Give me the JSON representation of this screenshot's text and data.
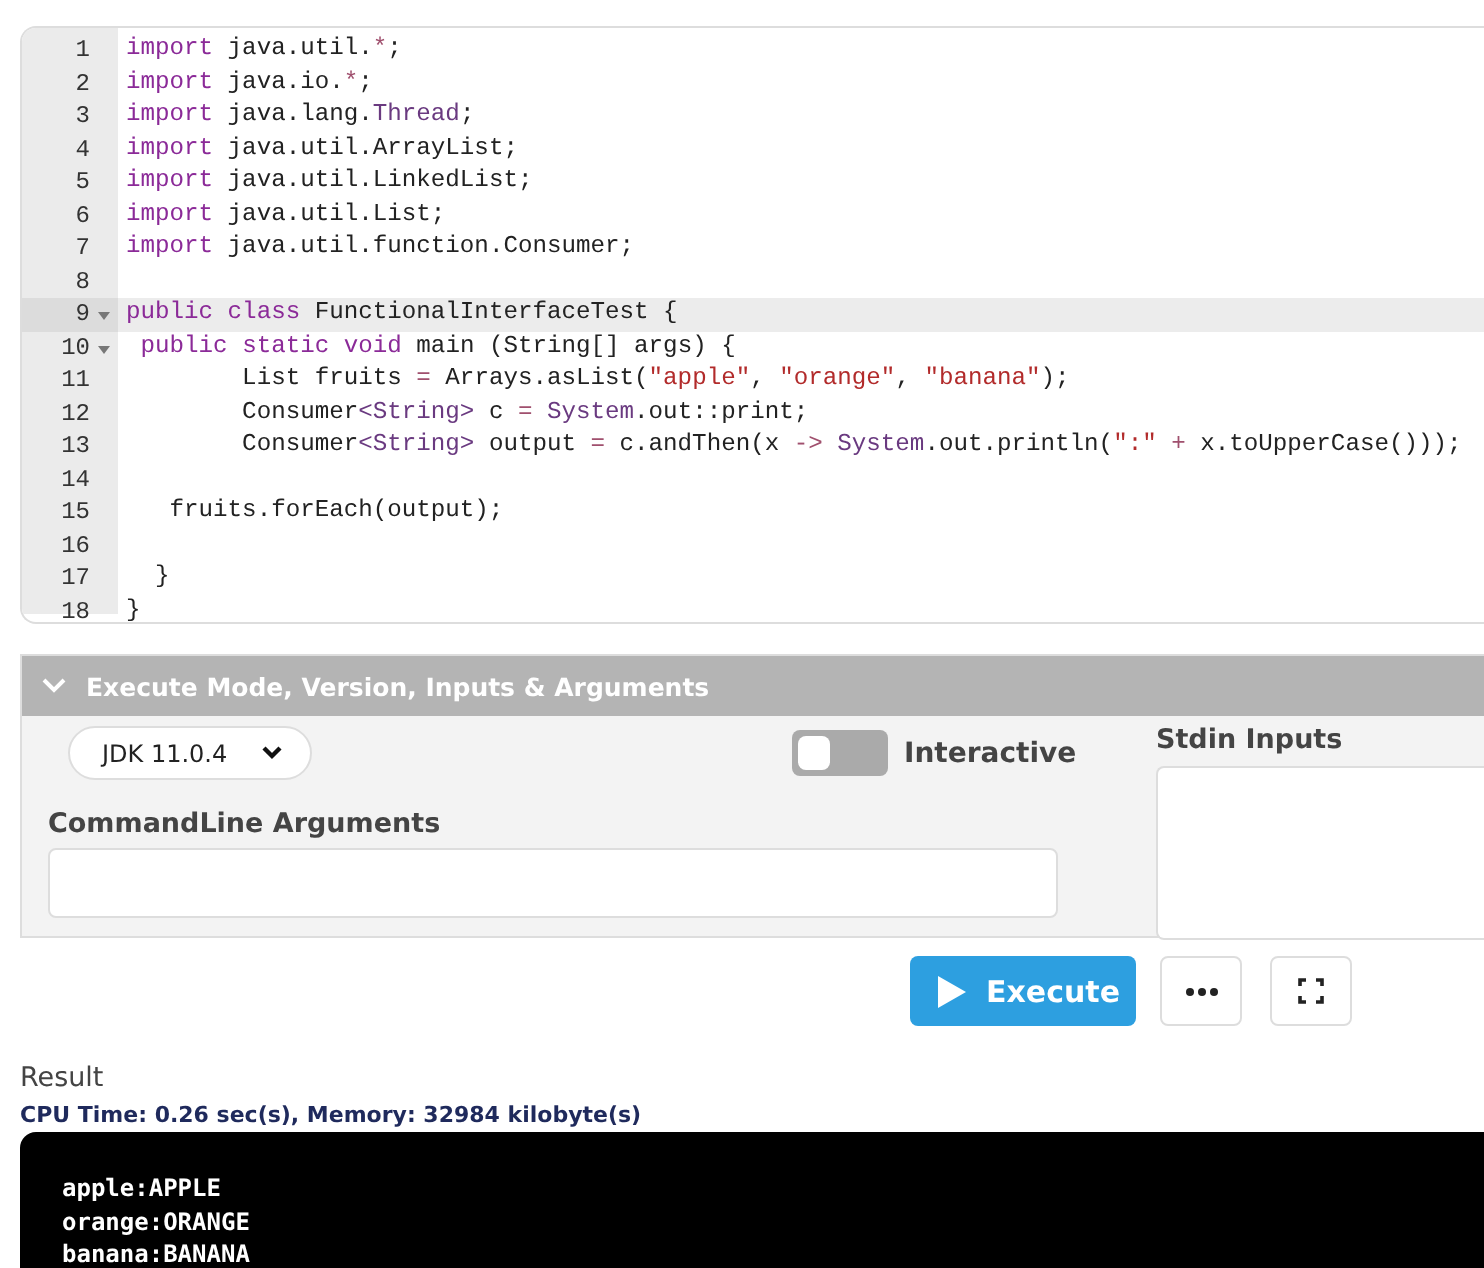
{
  "editor": {
    "lines": [
      {
        "number": "1",
        "foldable": false,
        "current": false,
        "tokens": [
          {
            "kind": "kw",
            "text": "import"
          },
          {
            "kind": "plain",
            "text": " java.util."
          },
          {
            "kind": "op",
            "text": "*"
          },
          {
            "kind": "plain",
            "text": ";"
          }
        ]
      },
      {
        "number": "2",
        "foldable": false,
        "current": false,
        "tokens": [
          {
            "kind": "kw",
            "text": "import"
          },
          {
            "kind": "plain",
            "text": " java.io."
          },
          {
            "kind": "op",
            "text": "*"
          },
          {
            "kind": "plain",
            "text": ";"
          }
        ]
      },
      {
        "number": "3",
        "foldable": false,
        "current": false,
        "tokens": [
          {
            "kind": "kw",
            "text": "import"
          },
          {
            "kind": "plain",
            "text": " java.lang."
          },
          {
            "kind": "type",
            "text": "Thread"
          },
          {
            "kind": "plain",
            "text": ";"
          }
        ]
      },
      {
        "number": "4",
        "foldable": false,
        "current": false,
        "tokens": [
          {
            "kind": "kw",
            "text": "import"
          },
          {
            "kind": "plain",
            "text": " java.util.ArrayList;"
          }
        ]
      },
      {
        "number": "5",
        "foldable": false,
        "current": false,
        "tokens": [
          {
            "kind": "kw",
            "text": "import"
          },
          {
            "kind": "plain",
            "text": " java.util.LinkedList;"
          }
        ]
      },
      {
        "number": "6",
        "foldable": false,
        "current": false,
        "tokens": [
          {
            "kind": "kw",
            "text": "import"
          },
          {
            "kind": "plain",
            "text": " java.util.List;"
          }
        ]
      },
      {
        "number": "7",
        "foldable": false,
        "current": false,
        "tokens": [
          {
            "kind": "kw",
            "text": "import"
          },
          {
            "kind": "plain",
            "text": " java.util.function.Consumer;"
          }
        ]
      },
      {
        "number": "8",
        "foldable": false,
        "current": false
      },
      {
        "number": "9",
        "foldable": true,
        "current": true,
        "tokens": [
          {
            "kind": "kw",
            "text": "public"
          },
          {
            "kind": "kw",
            "text": " class"
          },
          {
            "kind": "plain",
            "text": " FunctionalInterfaceTest {"
          }
        ]
      },
      {
        "number": "10",
        "foldable": true,
        "current": false,
        "tokens": [
          {
            "kind": "kw",
            "text": " public"
          },
          {
            "kind": "kw",
            "text": " static"
          },
          {
            "kind": "kw",
            "text": " void"
          },
          {
            "kind": "plain",
            "text": " main (String[] args) {"
          }
        ]
      },
      {
        "number": "11",
        "foldable": false,
        "current": false,
        "tokens": [
          {
            "kind": "plain",
            "text": "        List fruits "
          },
          {
            "kind": "op",
            "text": "="
          },
          {
            "kind": "plain",
            "text": " Arrays.asList("
          },
          {
            "kind": "str",
            "text": "\"apple\""
          },
          {
            "kind": "plain",
            "text": ", "
          },
          {
            "kind": "str",
            "text": "\"orange\""
          },
          {
            "kind": "plain",
            "text": ", "
          },
          {
            "kind": "str",
            "text": "\"banana\""
          },
          {
            "kind": "plain",
            "text": ");"
          }
        ]
      },
      {
        "number": "12",
        "foldable": false,
        "current": false,
        "tokens": [
          {
            "kind": "plain",
            "text": "        Consumer"
          },
          {
            "kind": "type",
            "text": "<String>"
          },
          {
            "kind": "plain",
            "text": " c "
          },
          {
            "kind": "op",
            "text": "="
          },
          {
            "kind": "type",
            "text": " System"
          },
          {
            "kind": "plain",
            "text": ".out::print;"
          }
        ]
      },
      {
        "number": "13",
        "foldable": false,
        "current": false,
        "tokens": [
          {
            "kind": "plain",
            "text": "        Consumer"
          },
          {
            "kind": "type",
            "text": "<String>"
          },
          {
            "kind": "plain",
            "text": " output "
          },
          {
            "kind": "op",
            "text": "="
          },
          {
            "kind": "plain",
            "text": " c.andThen(x "
          },
          {
            "kind": "op",
            "text": "->"
          },
          {
            "kind": "type",
            "text": " System"
          },
          {
            "kind": "plain",
            "text": ".out.println("
          },
          {
            "kind": "str",
            "text": "\":\""
          },
          {
            "kind": "op",
            "text": " +"
          },
          {
            "kind": "plain",
            "text": " x.toUpperCase()));"
          }
        ]
      },
      {
        "number": "14",
        "foldable": false,
        "current": false
      },
      {
        "number": "15",
        "foldable": false,
        "current": false,
        "tokens": [
          {
            "kind": "plain",
            "text": "   fruits.forEach(output);"
          }
        ]
      },
      {
        "number": "16",
        "foldable": false,
        "current": false
      },
      {
        "number": "17",
        "foldable": false,
        "current": false,
        "tokens": [
          {
            "kind": "plain",
            "text": "  }"
          }
        ]
      },
      {
        "number": "18",
        "foldable": false,
        "current": false,
        "tokens": [
          {
            "kind": "plain",
            "text": "}"
          }
        ]
      }
    ]
  },
  "settings": {
    "title": "Execute Mode, Version, Inputs & Arguments",
    "expanded": true,
    "version": "JDK 11.0.4",
    "interactive": {
      "label": "Interactive",
      "on": false
    },
    "args_label": "CommandLine Arguments",
    "stdin_label": "Stdin Inputs"
  },
  "actions": {
    "execute": "Execute"
  },
  "result": {
    "title": "Result",
    "stats": "CPU Time: 0.26 sec(s), Memory: 32984 kilobyte(s)",
    "output": [
      "apple:APPLE",
      "orange:ORANGE",
      "banana:BANANA"
    ]
  }
}
